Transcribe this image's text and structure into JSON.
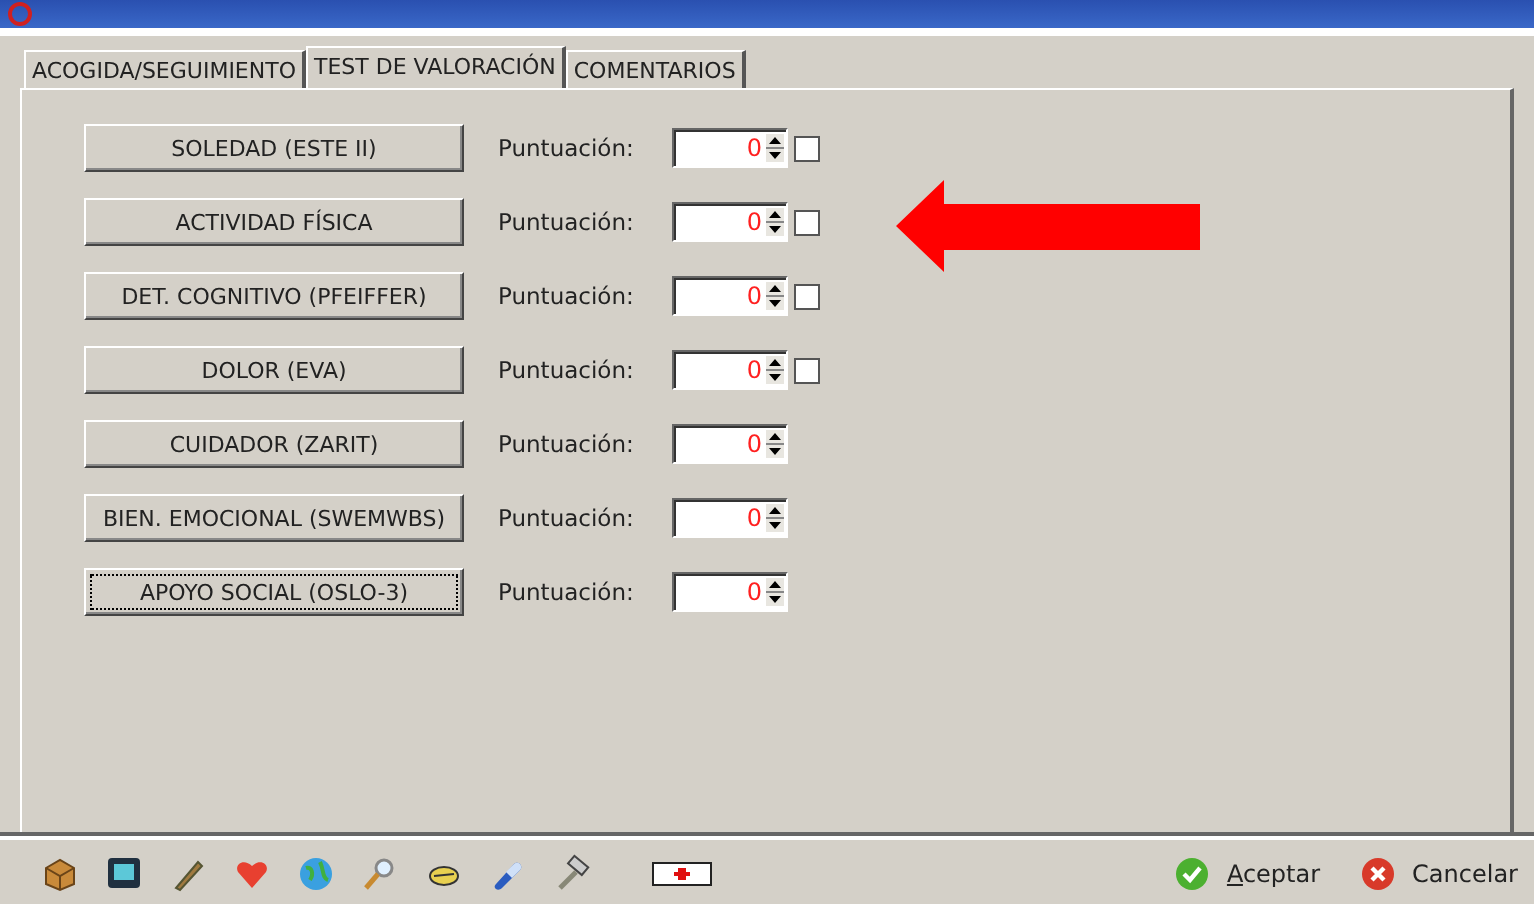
{
  "tabs": [
    {
      "label": "ACOGIDA/SEGUIMIENTO",
      "selected": false
    },
    {
      "label": "TEST DE VALORACIÓN",
      "selected": true
    },
    {
      "label": "COMENTARIOS",
      "selected": false
    }
  ],
  "tests": [
    {
      "label": "SOLEDAD (ESTE II)",
      "focused": false,
      "score_label": "Puntuación:",
      "score": "0",
      "kind": "with-checkbox",
      "checked": false
    },
    {
      "label": "ACTIVIDAD FÍSICA",
      "focused": false,
      "score_label": "Puntuación:",
      "score": "0",
      "kind": "with-checkbox",
      "checked": false
    },
    {
      "label": "DET. COGNITIVO (PFEIFFER)",
      "focused": false,
      "score_label": "Puntuación:",
      "score": "0",
      "kind": "with-checkbox",
      "checked": false
    },
    {
      "label": "DOLOR (EVA)",
      "focused": false,
      "score_label": "Puntuación:",
      "score": "0",
      "kind": "with-checkbox",
      "checked": false
    },
    {
      "label": "CUIDADOR (ZARIT)",
      "focused": false,
      "score_label": "Puntuación:",
      "score": "0",
      "kind": "plain"
    },
    {
      "label": "BIEN. EMOCIONAL (SWEMWBS)",
      "focused": false,
      "score_label": "Puntuación:",
      "score": "0",
      "kind": "plain"
    },
    {
      "label": "APOYO SOCIAL (OSLO-3)",
      "focused": true,
      "score_label": "Puntuación:",
      "score": "0",
      "kind": "plain"
    }
  ],
  "footer_buttons": [
    {
      "label": "Aceptar",
      "kind": "accept",
      "underline_first": true
    },
    {
      "label": "Cancelar",
      "kind": "cancel",
      "underline_first": false
    }
  ]
}
